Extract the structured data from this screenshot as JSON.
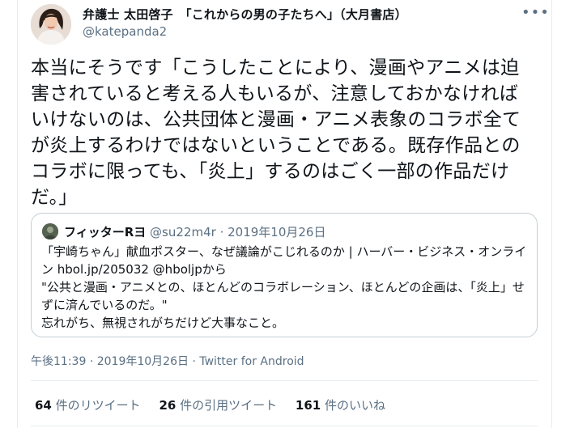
{
  "author": {
    "display_name": "弁護士 太田啓子　「これからの男の子たちへ」（大月書店）",
    "handle": "@katepanda2"
  },
  "more_icon": "more-horizontal-icon",
  "tweet_text": "本当にそうです「こうしたことにより、漫画やアニメは迫害されていると考える人もいるが、注意しておかなければいけないのは、公共団体と漫画・アニメ表象のコラボ全てが炎上するわけではないということである。既存作品とのコラボに限っても、「炎上」するのはごく一部の作品だけだ。」",
  "quote": {
    "name": "フィッターRヨ",
    "handle": "@su22m4r",
    "date": "2019年10月26日",
    "lines": [
      "「宇崎ちゃん」献血ポスター、なぜ議論がこじれるのか | ハーバー・ビジネス・オンライン hbol.jp/205032 @hboljpから",
      "\"公共と漫画・アニメとの、ほとんどのコラボレーション、ほとんどの企画は、「炎上」せずに済んでいるのだ。\"",
      "忘れがち、無視されがちだけど大事なこと。"
    ]
  },
  "meta": {
    "time": "午後11:39",
    "date": "2019年10月26日",
    "source": "Twitter for Android"
  },
  "stats": {
    "retweets": {
      "count": "64",
      "label": "件のリツイート"
    },
    "quotes": {
      "count": "26",
      "label": "件の引用ツイート"
    },
    "likes": {
      "count": "161",
      "label": "件のいいね"
    }
  }
}
